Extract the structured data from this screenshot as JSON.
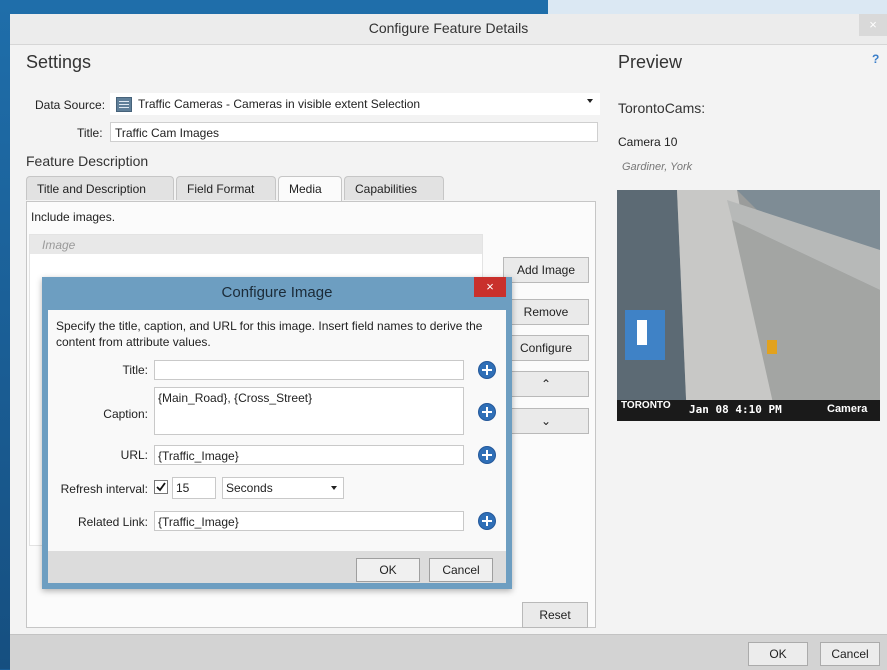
{
  "dialog": {
    "title": "Configure Feature Details",
    "close_glyph": "×"
  },
  "settings": {
    "heading": "Settings",
    "data_source_label": "Data Source:",
    "data_source_value": "Traffic Cameras - Cameras in visible extent Selection",
    "title_label": "Title:",
    "title_value": "Traffic Cam Images",
    "feature_description": "Feature Description",
    "tabs": [
      "Title and Description",
      "Field Format",
      "Media",
      "Capabilities"
    ],
    "active_tab": "Media",
    "include_text": "Include images.",
    "image_list_header": "Image",
    "buttons": {
      "add_image": "Add Image",
      "remove": "Remove",
      "configure": "Configure",
      "move_up": "⌃",
      "move_down": "⌄",
      "reset": "Reset"
    }
  },
  "preview": {
    "heading": "Preview",
    "help": "?",
    "layer_name": "TorontoCams:",
    "camera_title": "Camera 10",
    "camera_subtitle": "Gardiner, York",
    "overlay_logo": "TORONTO",
    "overlay_datetime": "Jan 08  4:10 PM",
    "overlay_camera": "Camera"
  },
  "configure_image": {
    "title": "Configure Image",
    "close_glyph": "×",
    "description": "Specify the title, caption, and URL for this image. Insert field names to derive the content from attribute values.",
    "title_label": "Title:",
    "title_value": "",
    "caption_label": "Caption:",
    "caption_value": "{Main_Road}, {Cross_Street}",
    "url_label": "URL:",
    "url_value": "{Traffic_Image}",
    "refresh_label": "Refresh interval:",
    "refresh_checked": true,
    "refresh_value": "15",
    "refresh_unit": "Seconds",
    "related_link_label": "Related Link:",
    "related_link_value": "{Traffic_Image}",
    "ok": "OK",
    "cancel": "Cancel"
  },
  "footer": {
    "ok": "OK",
    "cancel": "Cancel"
  },
  "colors": {
    "accent_blue": "#2f6fb7",
    "dialog_frame": "#6d9ec1",
    "close_red": "#c9302c"
  }
}
